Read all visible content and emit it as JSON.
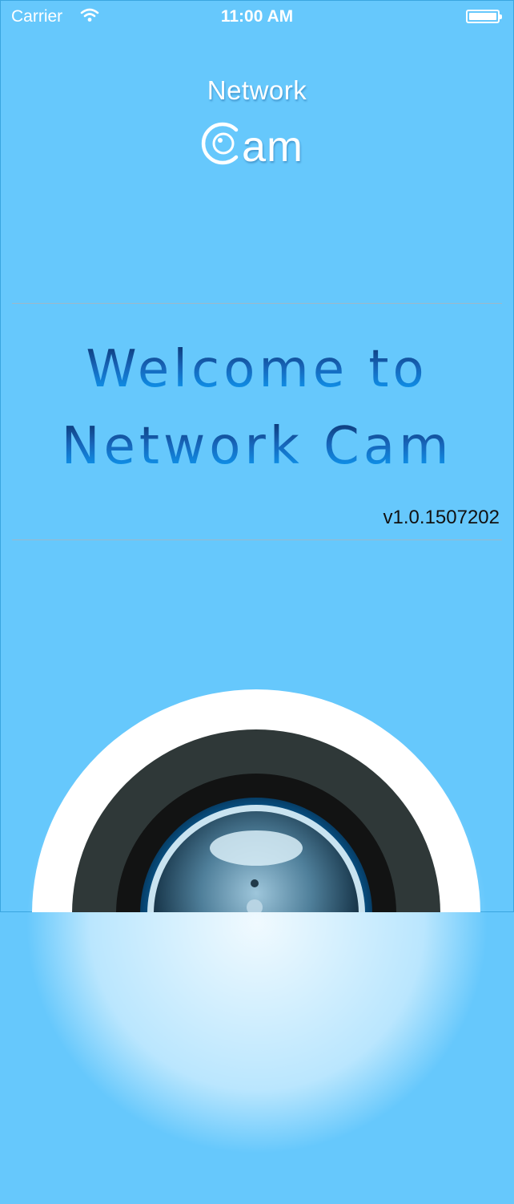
{
  "status_bar": {
    "carrier": "Carrier",
    "time": "11:00 AM",
    "wifi_icon": "wifi-icon",
    "battery_icon": "battery-icon"
  },
  "logo": {
    "line1": "Network",
    "line2": "am",
    "icon": "camera-lens-c-icon"
  },
  "welcome": {
    "line1": "Welcome to",
    "line2": "Network Cam"
  },
  "version": "v1.0.1507202",
  "colors": {
    "background": "#66c8fc",
    "welcome_gradient_top": "#0b2f68",
    "welcome_gradient_bottom": "#0aa5ff"
  }
}
